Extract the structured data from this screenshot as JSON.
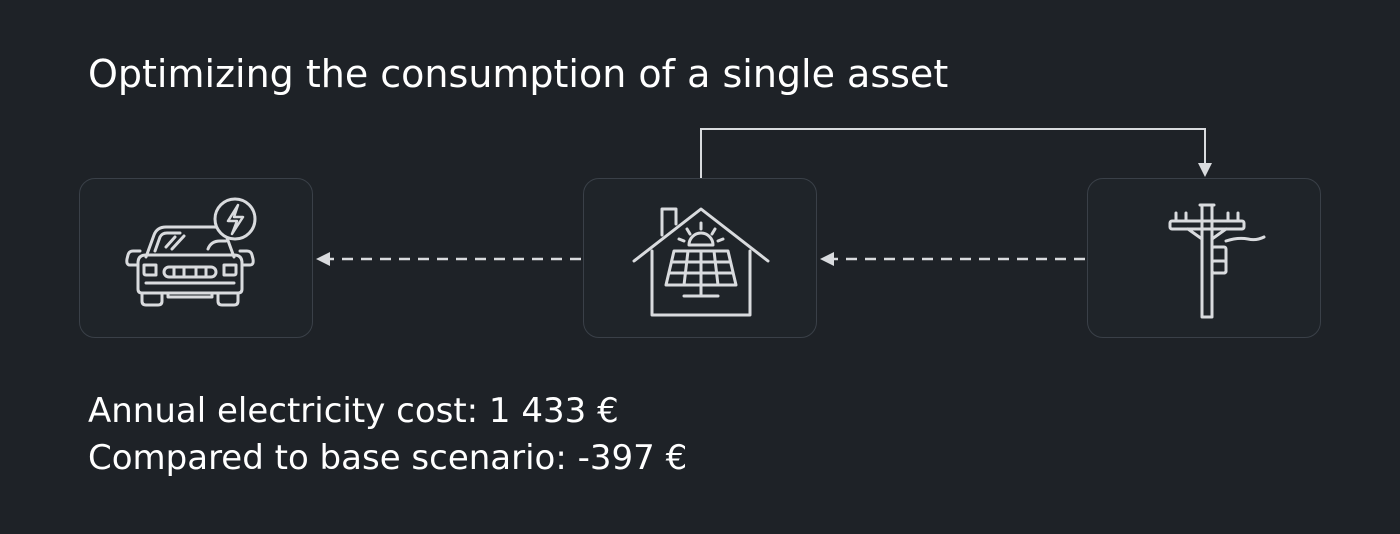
{
  "title": "Optimizing the consumption of a single asset",
  "nodes": [
    {
      "id": "ev",
      "icon": "electric-car-icon"
    },
    {
      "id": "house",
      "icon": "solar-house-icon"
    },
    {
      "id": "grid",
      "icon": "utility-pole-icon"
    }
  ],
  "edges": [
    {
      "from": "house",
      "to": "ev",
      "style": "dashed"
    },
    {
      "from": "grid",
      "to": "house",
      "style": "dashed"
    },
    {
      "from": "house",
      "to": "grid",
      "style": "solid"
    }
  ],
  "stats": {
    "annual_cost": "Annual electricity cost: 1 433 €",
    "comparison": "Compared to base scenario: -397 €"
  },
  "colors": {
    "background": "#1e2227",
    "node_border": "#3a4048",
    "line": "#d9dbde",
    "text": "#ffffff"
  }
}
